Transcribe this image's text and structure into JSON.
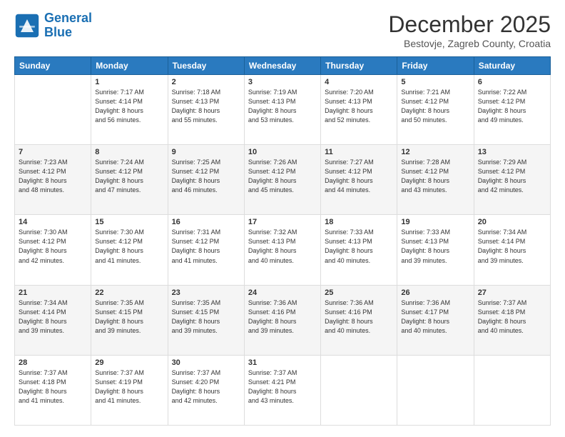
{
  "header": {
    "logo_line1": "General",
    "logo_line2": "Blue",
    "title": "December 2025",
    "subtitle": "Bestovje, Zagreb County, Croatia"
  },
  "weekdays": [
    "Sunday",
    "Monday",
    "Tuesday",
    "Wednesday",
    "Thursday",
    "Friday",
    "Saturday"
  ],
  "weeks": [
    [
      {
        "day": "",
        "info": ""
      },
      {
        "day": "1",
        "info": "Sunrise: 7:17 AM\nSunset: 4:14 PM\nDaylight: 8 hours\nand 56 minutes."
      },
      {
        "day": "2",
        "info": "Sunrise: 7:18 AM\nSunset: 4:13 PM\nDaylight: 8 hours\nand 55 minutes."
      },
      {
        "day": "3",
        "info": "Sunrise: 7:19 AM\nSunset: 4:13 PM\nDaylight: 8 hours\nand 53 minutes."
      },
      {
        "day": "4",
        "info": "Sunrise: 7:20 AM\nSunset: 4:13 PM\nDaylight: 8 hours\nand 52 minutes."
      },
      {
        "day": "5",
        "info": "Sunrise: 7:21 AM\nSunset: 4:12 PM\nDaylight: 8 hours\nand 50 minutes."
      },
      {
        "day": "6",
        "info": "Sunrise: 7:22 AM\nSunset: 4:12 PM\nDaylight: 8 hours\nand 49 minutes."
      }
    ],
    [
      {
        "day": "7",
        "info": "Sunrise: 7:23 AM\nSunset: 4:12 PM\nDaylight: 8 hours\nand 48 minutes."
      },
      {
        "day": "8",
        "info": "Sunrise: 7:24 AM\nSunset: 4:12 PM\nDaylight: 8 hours\nand 47 minutes."
      },
      {
        "day": "9",
        "info": "Sunrise: 7:25 AM\nSunset: 4:12 PM\nDaylight: 8 hours\nand 46 minutes."
      },
      {
        "day": "10",
        "info": "Sunrise: 7:26 AM\nSunset: 4:12 PM\nDaylight: 8 hours\nand 45 minutes."
      },
      {
        "day": "11",
        "info": "Sunrise: 7:27 AM\nSunset: 4:12 PM\nDaylight: 8 hours\nand 44 minutes."
      },
      {
        "day": "12",
        "info": "Sunrise: 7:28 AM\nSunset: 4:12 PM\nDaylight: 8 hours\nand 43 minutes."
      },
      {
        "day": "13",
        "info": "Sunrise: 7:29 AM\nSunset: 4:12 PM\nDaylight: 8 hours\nand 42 minutes."
      }
    ],
    [
      {
        "day": "14",
        "info": "Sunrise: 7:30 AM\nSunset: 4:12 PM\nDaylight: 8 hours\nand 42 minutes."
      },
      {
        "day": "15",
        "info": "Sunrise: 7:30 AM\nSunset: 4:12 PM\nDaylight: 8 hours\nand 41 minutes."
      },
      {
        "day": "16",
        "info": "Sunrise: 7:31 AM\nSunset: 4:12 PM\nDaylight: 8 hours\nand 41 minutes."
      },
      {
        "day": "17",
        "info": "Sunrise: 7:32 AM\nSunset: 4:13 PM\nDaylight: 8 hours\nand 40 minutes."
      },
      {
        "day": "18",
        "info": "Sunrise: 7:33 AM\nSunset: 4:13 PM\nDaylight: 8 hours\nand 40 minutes."
      },
      {
        "day": "19",
        "info": "Sunrise: 7:33 AM\nSunset: 4:13 PM\nDaylight: 8 hours\nand 39 minutes."
      },
      {
        "day": "20",
        "info": "Sunrise: 7:34 AM\nSunset: 4:14 PM\nDaylight: 8 hours\nand 39 minutes."
      }
    ],
    [
      {
        "day": "21",
        "info": "Sunrise: 7:34 AM\nSunset: 4:14 PM\nDaylight: 8 hours\nand 39 minutes."
      },
      {
        "day": "22",
        "info": "Sunrise: 7:35 AM\nSunset: 4:15 PM\nDaylight: 8 hours\nand 39 minutes."
      },
      {
        "day": "23",
        "info": "Sunrise: 7:35 AM\nSunset: 4:15 PM\nDaylight: 8 hours\nand 39 minutes."
      },
      {
        "day": "24",
        "info": "Sunrise: 7:36 AM\nSunset: 4:16 PM\nDaylight: 8 hours\nand 39 minutes."
      },
      {
        "day": "25",
        "info": "Sunrise: 7:36 AM\nSunset: 4:16 PM\nDaylight: 8 hours\nand 40 minutes."
      },
      {
        "day": "26",
        "info": "Sunrise: 7:36 AM\nSunset: 4:17 PM\nDaylight: 8 hours\nand 40 minutes."
      },
      {
        "day": "27",
        "info": "Sunrise: 7:37 AM\nSunset: 4:18 PM\nDaylight: 8 hours\nand 40 minutes."
      }
    ],
    [
      {
        "day": "28",
        "info": "Sunrise: 7:37 AM\nSunset: 4:18 PM\nDaylight: 8 hours\nand 41 minutes."
      },
      {
        "day": "29",
        "info": "Sunrise: 7:37 AM\nSunset: 4:19 PM\nDaylight: 8 hours\nand 41 minutes."
      },
      {
        "day": "30",
        "info": "Sunrise: 7:37 AM\nSunset: 4:20 PM\nDaylight: 8 hours\nand 42 minutes."
      },
      {
        "day": "31",
        "info": "Sunrise: 7:37 AM\nSunset: 4:21 PM\nDaylight: 8 hours\nand 43 minutes."
      },
      {
        "day": "",
        "info": ""
      },
      {
        "day": "",
        "info": ""
      },
      {
        "day": "",
        "info": ""
      }
    ]
  ]
}
